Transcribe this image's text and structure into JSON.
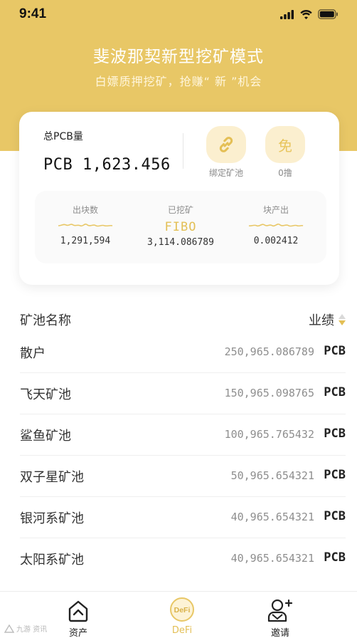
{
  "status_bar": {
    "time": "9:41"
  },
  "hero": {
    "title": "斐波那契新型挖矿模式",
    "subtitle": "白嫖质押挖矿，抢赚“ 新 ”机会"
  },
  "summary_card": {
    "total_label": "总PCB量",
    "total_value": "PCB  1,623.456",
    "actions": [
      {
        "label": "绑定矿池",
        "icon": "link-icon"
      },
      {
        "label": "0撸",
        "glyph": "免",
        "icon": "free-icon"
      }
    ],
    "stats": [
      {
        "label": "出块数",
        "value": "1,291,594"
      },
      {
        "label": "已挖矿",
        "highlight": "FIBO",
        "value": "3,114.086789"
      },
      {
        "label": "块产出",
        "value": "0.002412"
      }
    ]
  },
  "pool_list": {
    "header_left": "矿池名称",
    "header_right": "业绩",
    "rows": [
      {
        "name": "散户",
        "amount": "250,965.086789",
        "unit": "PCB"
      },
      {
        "name": "飞天矿池",
        "amount": "150,965.098765",
        "unit": "PCB"
      },
      {
        "name": "鲨鱼矿池",
        "amount": "100,965.765432",
        "unit": "PCB"
      },
      {
        "name": "双子星矿池",
        "amount": "50,965.654321",
        "unit": "PCB"
      },
      {
        "name": "银河系矿池",
        "amount": "40,965.654321",
        "unit": "PCB"
      },
      {
        "name": "太阳系矿池",
        "amount": "40,965.654321",
        "unit": "PCB"
      }
    ]
  },
  "tab_bar": {
    "tabs": [
      {
        "label": "资产",
        "icon": "home-icon"
      },
      {
        "label": "DeFi",
        "icon": "defi-icon",
        "icon_text": "DeFi"
      },
      {
        "label": "邀请",
        "icon": "add-user-icon"
      }
    ]
  },
  "watermark": "九游 资讯",
  "colors": {
    "accent": "#e8c766",
    "accent_text": "#e3bf55",
    "accent_light": "#fbefcf"
  }
}
